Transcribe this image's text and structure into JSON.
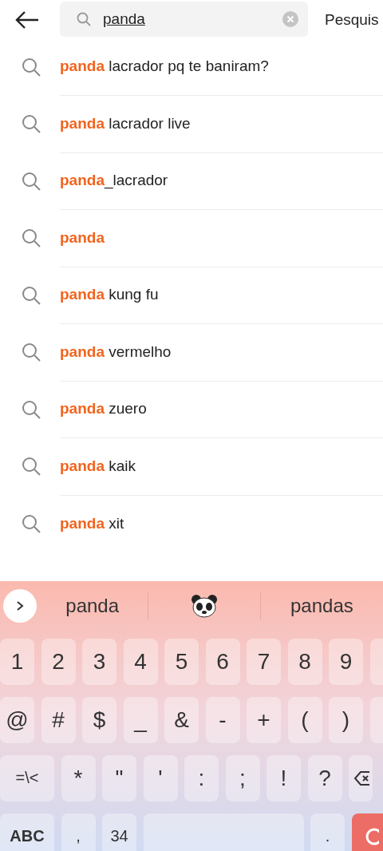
{
  "search": {
    "value": "panda",
    "action": "Pesquis"
  },
  "suggestions": [
    {
      "kind": "partial",
      "text": "**panda** lacrador pq te baniram?"
    },
    {
      "kind": "partial",
      "text": "**panda** lacrador live"
    },
    {
      "kind": "partial",
      "text": "**panda**_lacrador"
    },
    {
      "kind": "full",
      "text": "panda"
    },
    {
      "kind": "partial",
      "text": "**panda** kung fu"
    },
    {
      "kind": "partial",
      "text": "**panda** vermelho"
    },
    {
      "kind": "partial",
      "text": "**panda** zuero"
    },
    {
      "kind": "partial",
      "text": "**panda** kaik"
    },
    {
      "kind": "partial",
      "text": "**panda** xit"
    }
  ],
  "keyboard": {
    "candidates": [
      {
        "kind": "word",
        "text": "panda"
      },
      {
        "kind": "panda_emoji"
      },
      {
        "kind": "word",
        "text": "pandas"
      }
    ],
    "rows": [
      [
        {
          "kind": "key",
          "label": "1"
        },
        {
          "kind": "key",
          "label": "2"
        },
        {
          "kind": "key",
          "label": "3"
        },
        {
          "kind": "key",
          "label": "4"
        },
        {
          "kind": "key",
          "label": "5"
        },
        {
          "kind": "key",
          "label": "6"
        },
        {
          "kind": "key",
          "label": "7"
        },
        {
          "kind": "key",
          "label": "8"
        },
        {
          "kind": "key",
          "label": "9"
        },
        {
          "kind": "blank"
        }
      ],
      [
        {
          "kind": "key",
          "label": "@"
        },
        {
          "kind": "key",
          "label": "#"
        },
        {
          "kind": "key",
          "label": "$"
        },
        {
          "kind": "key",
          "label": "_"
        },
        {
          "kind": "key",
          "label": "&"
        },
        {
          "kind": "key",
          "label": "-"
        },
        {
          "kind": "key",
          "label": "+"
        },
        {
          "kind": "key",
          "label": "("
        },
        {
          "kind": "key",
          "label": ")"
        },
        {
          "kind": "blank"
        }
      ],
      [
        {
          "kind": "wide",
          "label": "=\\<"
        },
        {
          "kind": "key",
          "label": "*"
        },
        {
          "kind": "key",
          "label": "\""
        },
        {
          "kind": "key",
          "label": "'"
        },
        {
          "kind": "key",
          "label": ":"
        },
        {
          "kind": "key",
          "label": ";"
        },
        {
          "kind": "key",
          "label": "!"
        },
        {
          "kind": "key",
          "label": "?"
        },
        {
          "kind": "backspace"
        }
      ],
      [
        {
          "kind": "wide",
          "label": "ABC"
        },
        {
          "kind": "key",
          "label": ","
        },
        {
          "kind": "key",
          "label": "34"
        },
        {
          "kind": "space"
        },
        {
          "kind": "key",
          "label": "."
        },
        {
          "kind": "enter"
        }
      ]
    ]
  }
}
